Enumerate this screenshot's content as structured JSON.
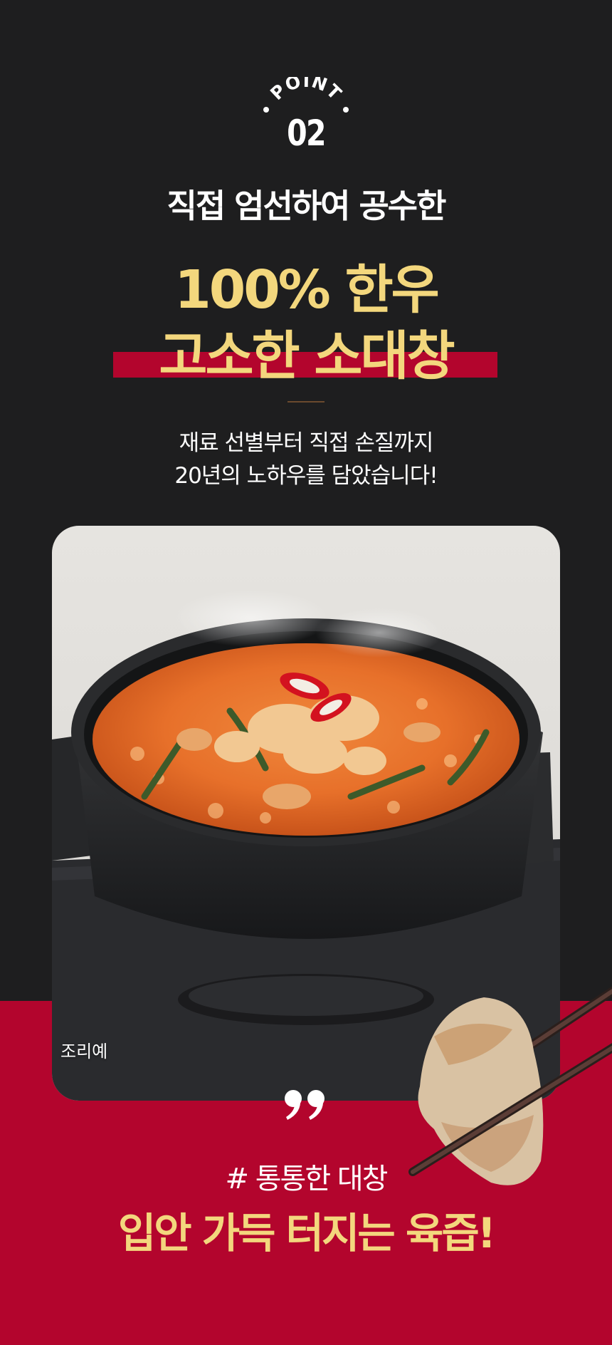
{
  "badge": {
    "arc_text": "POINT",
    "number": "02"
  },
  "subhead": "직접 엄선하여 공수한",
  "headline": {
    "line1": "100% 한우",
    "line2": "고소한 소대창"
  },
  "description": {
    "line1": "재료 선별부터 직접 손질까지",
    "line2": "20년의 노하우를 담았습니다!"
  },
  "photo": {
    "caption": "조리예",
    "icon": "stew-pot-photo"
  },
  "quote_icon": "closing-quote-icon",
  "hashtag": "# 통통한 대창",
  "tagline": "입안 가득 터지는 육즙!",
  "colors": {
    "background_dark": "#1e1e1f",
    "accent_red": "#b3052d",
    "accent_yellow": "#f3d77d",
    "text_white": "#ffffff"
  }
}
